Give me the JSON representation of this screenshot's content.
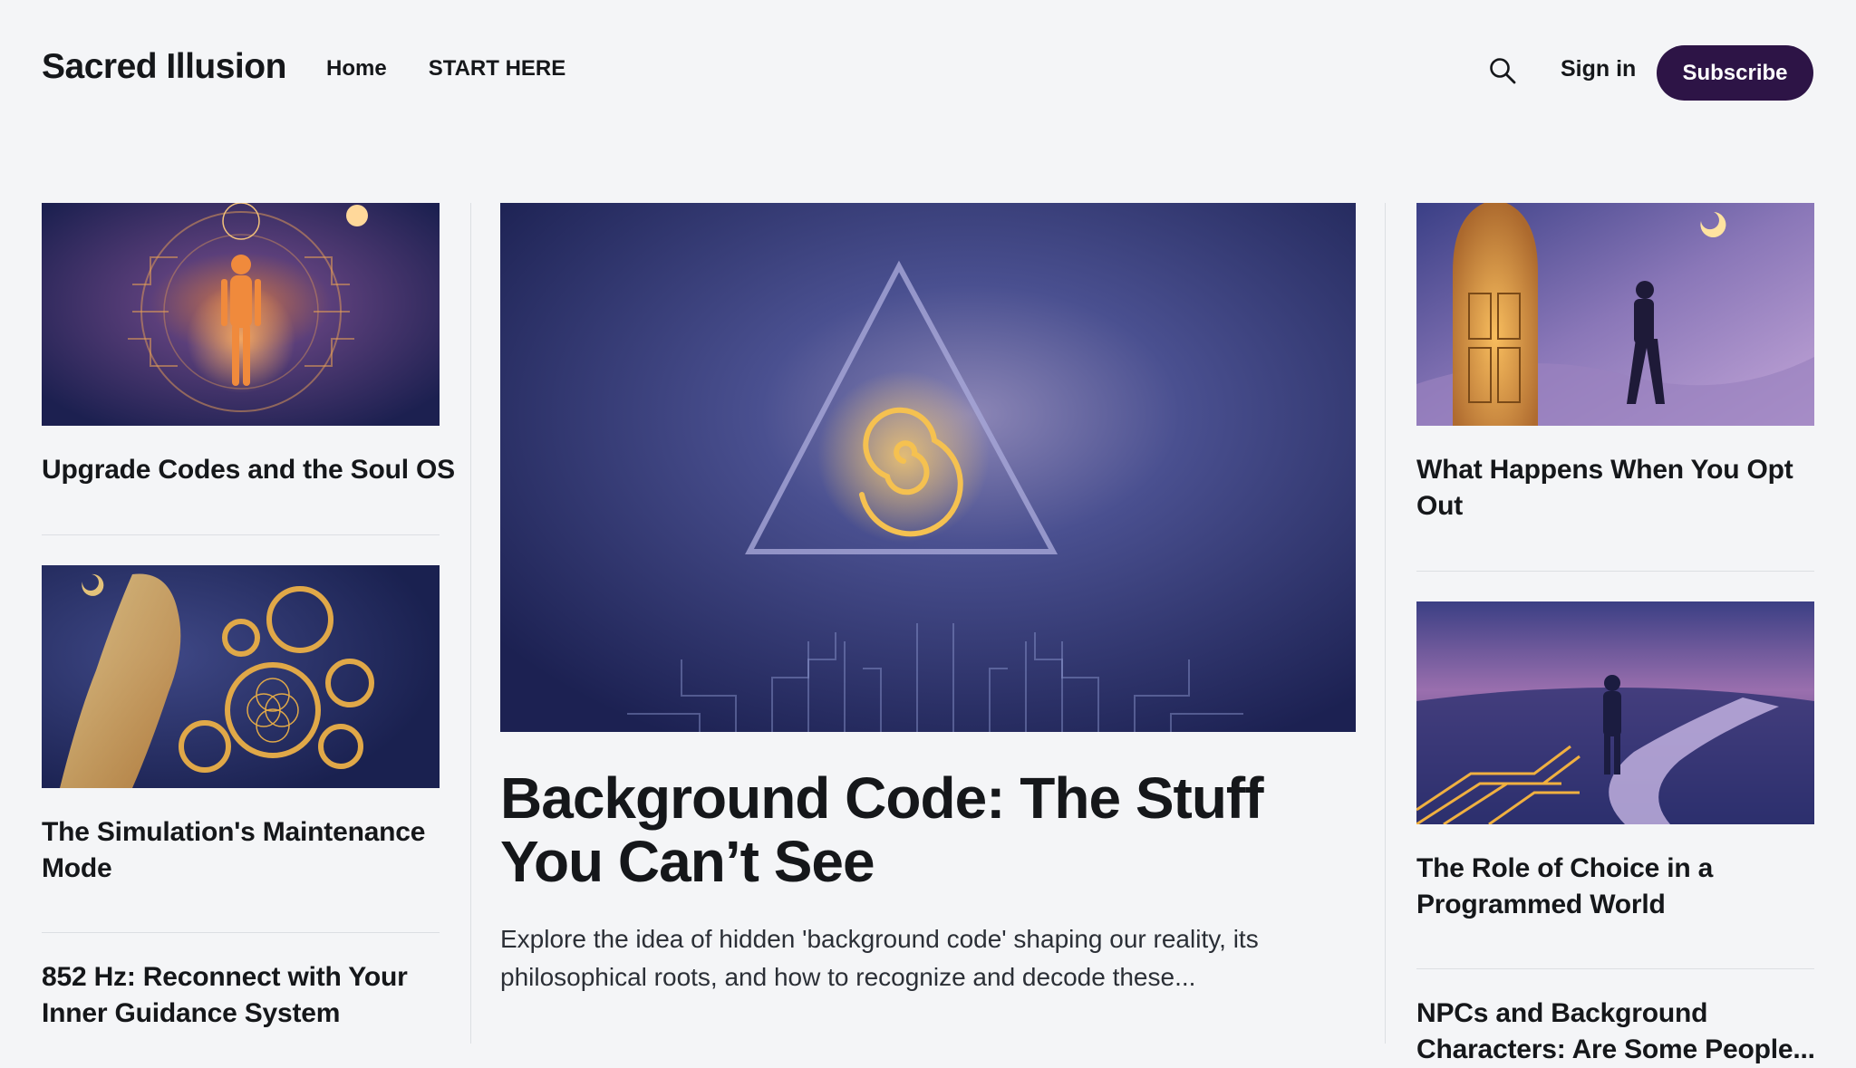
{
  "site": {
    "title": "Sacred Illusion"
  },
  "nav": {
    "items": [
      {
        "label": "Home"
      },
      {
        "label": "START HERE"
      }
    ]
  },
  "header": {
    "sign_in": "Sign in",
    "subscribe": "Subscribe",
    "search_icon": "search-icon"
  },
  "left_column": [
    {
      "title": "Upgrade Codes and the Soul OS"
    },
    {
      "title": "The Simulation's Maintenance Mode"
    },
    {
      "title": "852 Hz: Reconnect with Your Inner Guidance System"
    }
  ],
  "featured": {
    "title": "Background Code: The Stuff You Can’t See",
    "excerpt": "Explore the idea of hidden 'background code' shaping our reality, its philosophical roots, and how to recognize and decode these..."
  },
  "right_column": [
    {
      "title": "What Happens When You Opt Out"
    },
    {
      "title": "The Role of Choice in a Programmed World"
    },
    {
      "title": "NPCs and Background Characters: Are Some People..."
    }
  ],
  "colors": {
    "accent": "#2d1446",
    "background": "#f4f5f7",
    "gold": "#f0b848",
    "night": "#1f2555"
  }
}
